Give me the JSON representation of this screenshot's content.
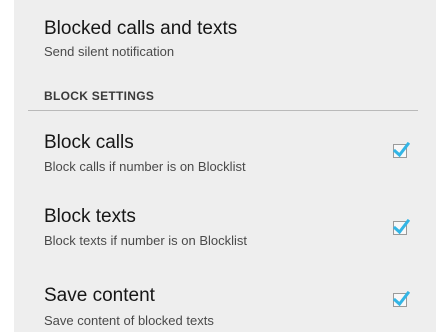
{
  "blocked_calls_and_texts": {
    "title": "Blocked calls and texts",
    "summary": "Send silent notification"
  },
  "block_settings": {
    "header": "BLOCK SETTINGS",
    "items": [
      {
        "title": "Block calls",
        "summary": "Block calls if number is on Blocklist",
        "checked": true
      },
      {
        "title": "Block texts",
        "summary": "Block texts if number is on Blocklist",
        "checked": true
      },
      {
        "title": "Save content",
        "summary": "Save content of blocked texts",
        "checked": true
      }
    ]
  },
  "colors": {
    "background": "#eeeeee",
    "check_accent": "#33b5e5",
    "divider": "#b9b9b9"
  },
  "icons": {
    "checkbox_checked": "checkmark-icon"
  }
}
